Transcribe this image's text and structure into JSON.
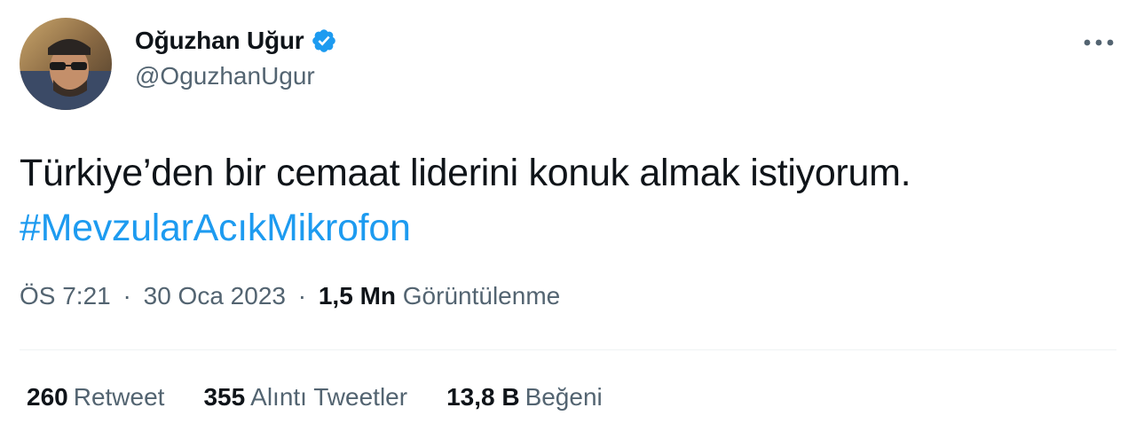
{
  "author": {
    "display_name": "Oğuzhan Uğur",
    "handle": "@OguzhanUgur",
    "verified": true
  },
  "tweet": {
    "text": "Türkiye’den bir cemaat liderini konuk almak istiyorum.",
    "hashtag": "#MevzularAcıkMikrofon"
  },
  "meta": {
    "time": "ÖS 7:21",
    "separator": "·",
    "date": "30 Oca 2023",
    "views_count": "1,5 Mn",
    "views_label": "Görüntülenme"
  },
  "stats": {
    "retweets": {
      "count": "260",
      "label": "Retweet"
    },
    "quotes": {
      "count": "355",
      "label": "Alıntı Tweetler"
    },
    "likes": {
      "count": "13,8 B",
      "label": "Beğeni"
    }
  },
  "icons": {
    "verified": "verified-badge-icon",
    "more": "more-options-icon"
  },
  "colors": {
    "text_primary": "#0f1419",
    "text_secondary": "#536471",
    "accent": "#1d9bf0",
    "divider": "#eff3f4"
  }
}
